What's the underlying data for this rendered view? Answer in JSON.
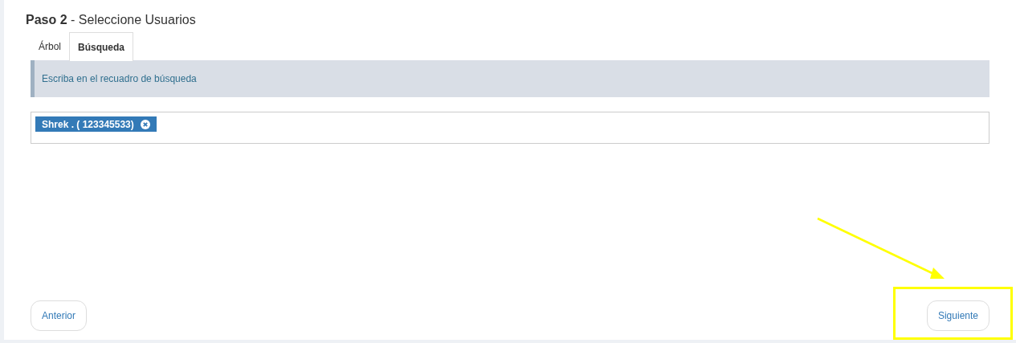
{
  "title": "**Paso 2** - Seleccione Usuarios",
  "tabs": [
    {
      "label": "Árbol",
      "selected": false
    },
    {
      "label": "Búsqueda",
      "selected": true
    }
  ],
  "alert": "Escriba en el recuadro de búsqueda",
  "selected_users": [
    {
      "label": "Shrek . ( 123345533)"
    }
  ],
  "buttons": {
    "previous": "Anterior",
    "next": "Siguiente"
  }
}
